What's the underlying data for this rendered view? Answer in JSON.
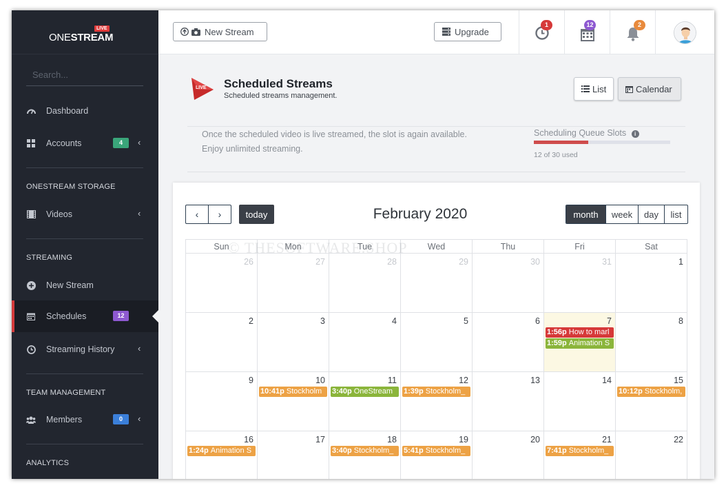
{
  "app": {
    "brand": {
      "one": "ONE",
      "stream": "STREAM",
      "live": "LIVE"
    }
  },
  "sidebar": {
    "search_placeholder": "Search...",
    "items": [
      {
        "label": "Dashboard"
      },
      {
        "label": "Accounts",
        "badge": "4"
      },
      {
        "label": "Videos"
      },
      {
        "label": "New Stream"
      },
      {
        "label": "Schedules",
        "badge": "12"
      },
      {
        "label": "Streaming History"
      },
      {
        "label": "Members",
        "badge": "0"
      }
    ],
    "sections": {
      "storage": "ONESTREAM STORAGE",
      "streaming": "STREAMING",
      "team": "TEAM MANAGEMENT",
      "analytics": "ANALYTICS"
    },
    "colors": {
      "accounts_badge": "#3aa57a",
      "schedules_badge": "#8e59d1",
      "members_badge": "#3b7fd9",
      "active_accent": "#d43b3b"
    }
  },
  "topbar": {
    "new_stream": "New Stream",
    "upgrade": "Upgrade",
    "history_badge": "1",
    "calendar_badge": "12",
    "notifications_badge": "2",
    "colors": {
      "history_badge": "#d63939",
      "calendar_badge": "#8e59d1",
      "notifications_badge": "#e88a3c"
    }
  },
  "page": {
    "title": "Scheduled Streams",
    "subtitle": "Scheduled streams management.",
    "view_list": "List",
    "view_calendar": "Calendar",
    "info_line1": "Once the scheduled video is live streamed, the slot is again available.",
    "info_line2": "Enjoy unlimited streaming.",
    "queue_label": "Scheduling Queue Slots",
    "queue_used_text": "12 of 30 used",
    "queue_fraction": 0.4
  },
  "calendar": {
    "today_label": "today",
    "title": "February 2020",
    "views": [
      "month",
      "week",
      "day",
      "list"
    ],
    "active_view": "month",
    "weekdays": [
      "Sun",
      "Mon",
      "Tue",
      "Wed",
      "Thu",
      "Fri",
      "Sat"
    ],
    "watermark": "© THESOFTWARE.SHOP",
    "weeks": [
      [
        {
          "d": "26",
          "other": true
        },
        {
          "d": "27",
          "other": true
        },
        {
          "d": "28",
          "other": true
        },
        {
          "d": "29",
          "other": true
        },
        {
          "d": "30",
          "other": true
        },
        {
          "d": "31",
          "other": true
        },
        {
          "d": "1"
        }
      ],
      [
        {
          "d": "2"
        },
        {
          "d": "3"
        },
        {
          "d": "4"
        },
        {
          "d": "5"
        },
        {
          "d": "6"
        },
        {
          "d": "7",
          "today": true,
          "events": [
            {
              "time": "1:56p",
              "title": "How to marl",
              "color": "#d63939"
            },
            {
              "time": "1:59p",
              "title": "Animation S",
              "color": "#8bb53b"
            }
          ]
        },
        {
          "d": "8"
        }
      ],
      [
        {
          "d": "9"
        },
        {
          "d": "10",
          "events": [
            {
              "time": "10:41p",
              "title": "Stockholm",
              "color": "#eda245"
            }
          ]
        },
        {
          "d": "11",
          "events": [
            {
              "time": "3:40p",
              "title": "OneStream",
              "color": "#8bb53b"
            }
          ]
        },
        {
          "d": "12",
          "events": [
            {
              "time": "1:39p",
              "title": "Stockholm_",
              "color": "#eda245"
            }
          ]
        },
        {
          "d": "13"
        },
        {
          "d": "14"
        },
        {
          "d": "15",
          "events": [
            {
              "time": "10:12p",
              "title": "Stockholm,",
              "color": "#eda245"
            }
          ]
        }
      ],
      [
        {
          "d": "16",
          "events": [
            {
              "time": "1:24p",
              "title": "Animation S",
              "color": "#eda245"
            }
          ]
        },
        {
          "d": "17"
        },
        {
          "d": "18",
          "events": [
            {
              "time": "3:40p",
              "title": "Stockholm_",
              "color": "#eda245"
            }
          ]
        },
        {
          "d": "19",
          "events": [
            {
              "time": "5:41p",
              "title": "Stockholm_",
              "color": "#eda245"
            }
          ]
        },
        {
          "d": "20"
        },
        {
          "d": "21",
          "events": [
            {
              "time": "7:41p",
              "title": "Stockholm_",
              "color": "#eda245"
            }
          ]
        },
        {
          "d": "22"
        }
      ]
    ]
  }
}
